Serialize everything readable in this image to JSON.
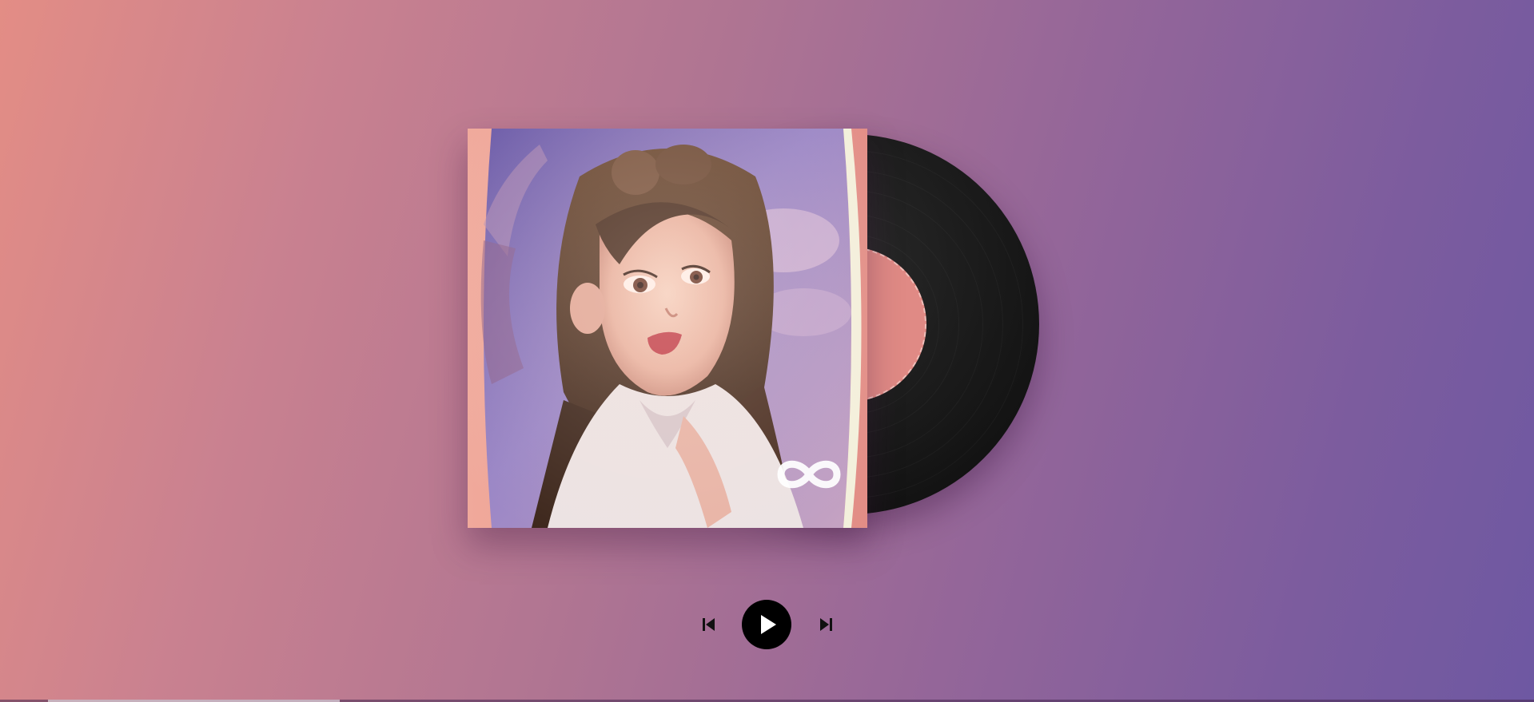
{
  "player": {
    "state": "paused",
    "progress_fraction": 0.19
  },
  "cover": {
    "logo_icon": "infinity-icon"
  },
  "controls": {
    "previous_icon": "skip-previous-icon",
    "play_icon": "play-icon",
    "next_icon": "skip-next-icon"
  },
  "colors": {
    "background_start": "#e38d85",
    "background_end": "#6e58a2",
    "record": "#1a1a1a",
    "record_label": "#e08a85",
    "play_button": "#000000"
  }
}
